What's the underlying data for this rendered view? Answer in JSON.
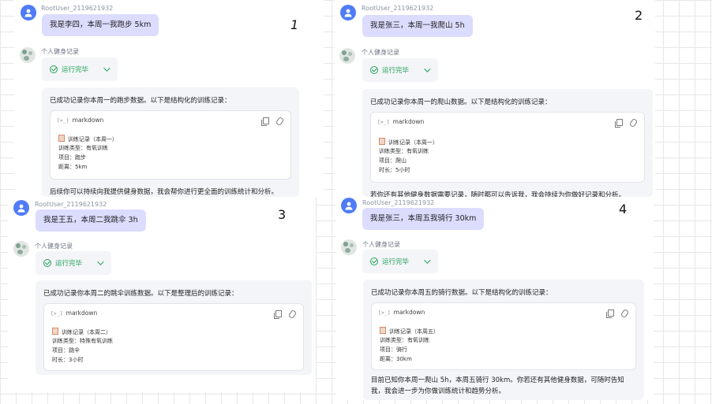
{
  "panels": [
    {
      "number": "1",
      "user_name": "RootUser_2119621932",
      "user_message": "我是李四，本周一我跑步 5km",
      "bot_name": "个人健身记录",
      "status": "运行完毕",
      "intro": "已成功记录你本周一的跑步数据。以下是结构化的训练记录：",
      "code_lang": "markdown",
      "code_lines": [
        "训练记录（本周一）",
        "训练类型：有氧训练",
        "项目：跑步",
        "距离：5km"
      ],
      "tail": "后续你可以持续向我提供健身数据，我会帮你进行更全面的训练统计和分析。"
    },
    {
      "number": "2",
      "user_name": "RootUser_2119621932",
      "user_message": "我是张三，本周一我爬山 5h",
      "bot_name": "个人健身记录",
      "status": "运行完毕",
      "intro": "已成功记录你本周一的爬山数据。以下是结构化的训练记录：",
      "code_lang": "markdown",
      "code_lines": [
        "训练记录（本周一）",
        "训练类型：有氧训练",
        "项目：爬山",
        "时长：5小时"
      ],
      "tail": "若你还有其他健身数据需要记录，随时都可以告诉我，我会持续为你做好记录和分析。"
    },
    {
      "number": "3",
      "user_name": "RootUser_2119621932",
      "user_message": "我是王五，本周二我跳伞 3h",
      "bot_name": "个人健身记录",
      "status": "运行完毕",
      "intro": "已成功记录你本周二的跳伞训练数据。以下是整理后的训练记录：",
      "code_lang": "markdown",
      "code_lines": [
        "训练记录（本周二）",
        "训练类型：特殊有氧训练",
        "项目：跳伞",
        "时长：3小时"
      ]
    },
    {
      "number": "4",
      "user_name": "RootUser_2119621932",
      "user_message": "我是张三，本周五我骑行 30km",
      "bot_name": "个人健身记录",
      "status": "运行完毕",
      "intro": "已成功记录你本周五的骑行数据。以下是结构化的训练记录：",
      "code_lang": "markdown",
      "code_lines": [
        "训练记录（本周五）",
        "训练类型：有氧训练",
        "项目：骑行",
        "距离：30km"
      ],
      "tail_lines": [
        "目前已知你本周一爬山 5h，本周五骑行 30km。你若还有其他健身数据，可随时告知",
        "我，我会进一步为你做训练统计和趋势分析。"
      ]
    }
  ]
}
